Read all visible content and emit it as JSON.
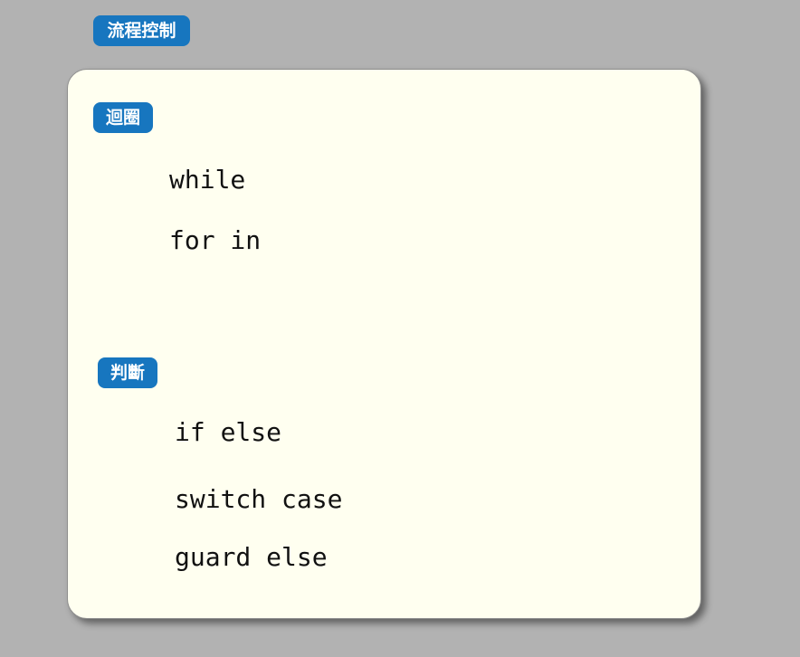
{
  "title": "流程控制",
  "sections": {
    "loop": {
      "label": "迴圈",
      "items": [
        "while",
        "for in"
      ]
    },
    "condition": {
      "label": "判斷",
      "items": [
        "if else",
        "switch case",
        "guard else"
      ]
    }
  },
  "colors": {
    "background": "#b2b2b2",
    "card": "#fffff0",
    "badge": "#1776bf",
    "badge_text": "#ffffff",
    "text": "#111111"
  }
}
